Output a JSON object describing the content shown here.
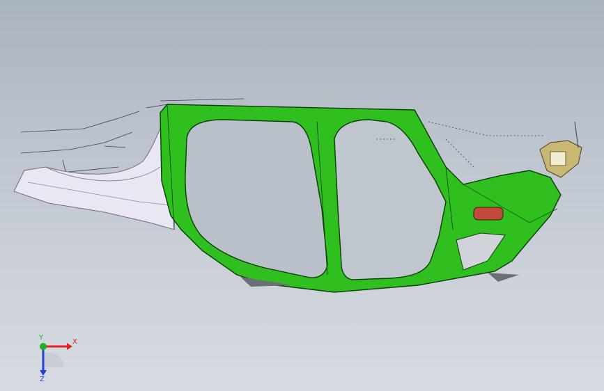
{
  "viewport": {
    "background_top": "#aab3bf",
    "background_bottom": "#d7dbe1"
  },
  "model": {
    "icon": "body-side-panel-icon",
    "main_color": "#2fbf1f",
    "edge_color": "#0a3d08",
    "surface_color": "#e9e7f1",
    "bracket_color": "#c9b774"
  },
  "triad": {
    "x_label": "X",
    "y_label": "Y",
    "z_label": "Z",
    "x_color": "#e02020",
    "y_color": "#20b020",
    "z_color": "#2040d0"
  }
}
